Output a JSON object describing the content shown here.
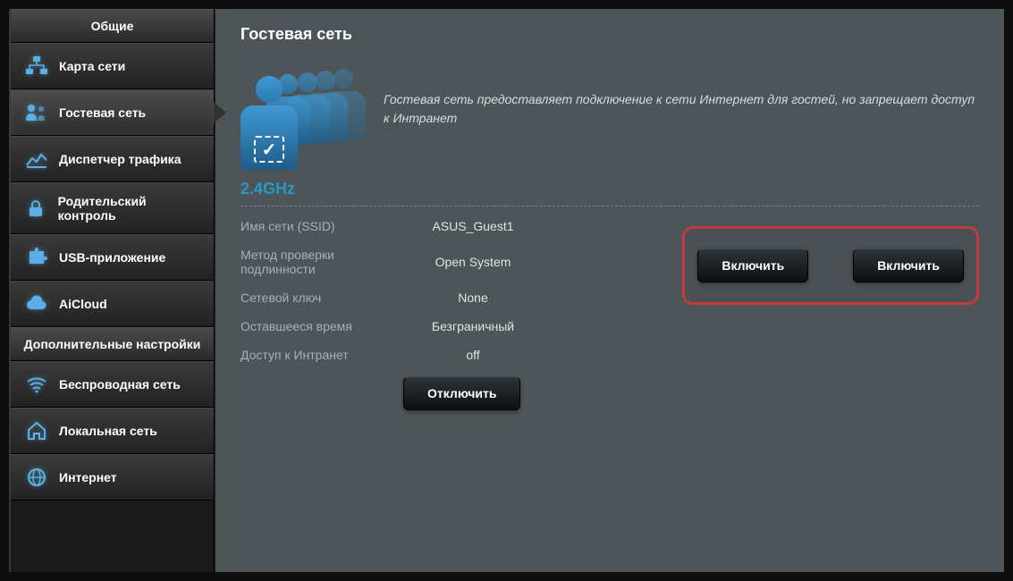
{
  "sidebar": {
    "general_header": "Общие",
    "advanced_header": "Дополнительные настройки",
    "general_items": [
      {
        "label": "Карта сети"
      },
      {
        "label": "Гостевая сеть"
      },
      {
        "label": "Диспетчер трафика"
      },
      {
        "label": "Родительский контроль"
      },
      {
        "label": "USB-приложение"
      },
      {
        "label": "AiCloud"
      }
    ],
    "advanced_items": [
      {
        "label": "Беспроводная сеть"
      },
      {
        "label": "Локальная сеть"
      },
      {
        "label": "Интернет"
      }
    ]
  },
  "main": {
    "title": "Гостевая сеть",
    "banner_text": "Гостевая сеть предоставляет подключение к сети Интернет для гостей, но запрещает доступ к Интранет",
    "band": "2.4GHz",
    "fields": {
      "ssid_label": "Имя сети (SSID)",
      "ssid_value": "ASUS_Guest1",
      "auth_label": "Метод проверки подлинности",
      "auth_value": "Open System",
      "key_label": "Сетевой ключ",
      "key_value": "None",
      "time_label": "Оставшееся время",
      "time_value": "Безграничный",
      "intranet_label": "Доступ к Интранет",
      "intranet_value": "off"
    },
    "buttons": {
      "enable1": "Включить",
      "enable2": "Включить",
      "disable": "Отключить"
    }
  }
}
